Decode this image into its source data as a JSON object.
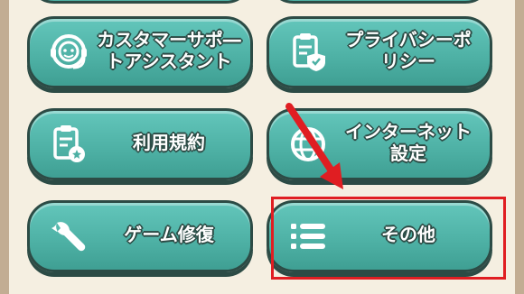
{
  "menu": {
    "buttons": [
      {
        "id": "support",
        "label": "カスタマーサポ―\nトアシスタント",
        "icon": "headset-support-icon"
      },
      {
        "id": "privacy",
        "label": "プライバシーポ\nリシー",
        "icon": "clipboard-shield-icon"
      },
      {
        "id": "terms",
        "label": "利用規約",
        "icon": "clipboard-badge-icon"
      },
      {
        "id": "internet",
        "label": "インターネット\n設定",
        "icon": "globe-icon"
      },
      {
        "id": "repair",
        "label": "ゲーム修復",
        "icon": "wrench-icon"
      },
      {
        "id": "other",
        "label": "その他",
        "icon": "list-icon"
      }
    ]
  },
  "annotation": {
    "highlight_color": "#e01e22",
    "arrow_icon": "red-arrow-icon"
  },
  "colors": {
    "button_fill": "#4db0a4",
    "button_border": "#2c4b45",
    "panel_bg": "#f5efe1",
    "frame_bg": "#c2ad93"
  }
}
